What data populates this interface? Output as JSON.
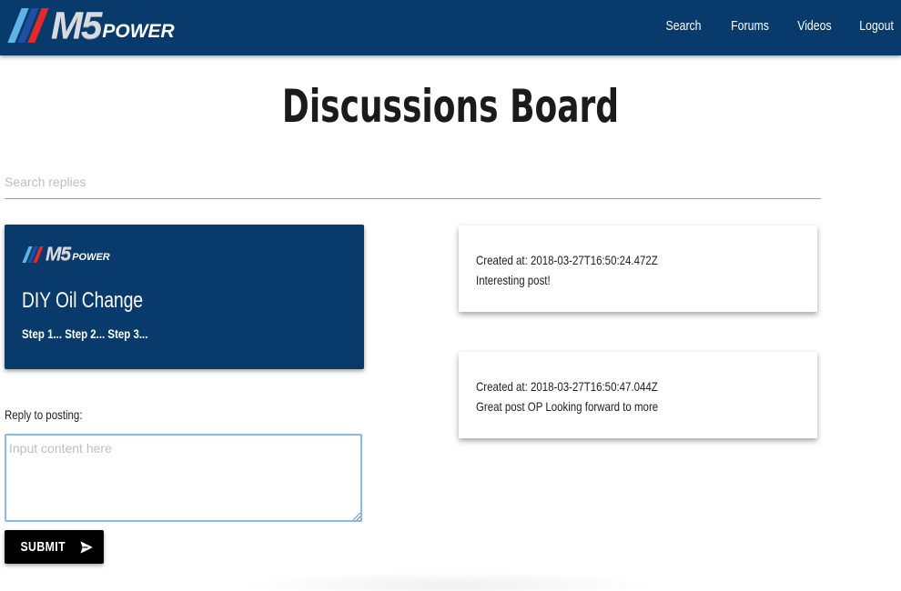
{
  "header": {
    "logo_brand": "M5",
    "logo_suffix": "POWER",
    "nav": [
      "Search",
      "Forums",
      "Videos",
      "Logout"
    ]
  },
  "page_title": "Discussions Board",
  "search": {
    "placeholder": "Search replies",
    "value": ""
  },
  "post": {
    "logo_brand": "M5",
    "logo_suffix": "POWER",
    "title": "DIY Oil Change",
    "body": "Step 1... Step 2... Step 3..."
  },
  "reply_form": {
    "label": "Reply to posting:",
    "placeholder": "Input content here",
    "submit_label": "SUBMIT"
  },
  "replies": [
    {
      "created": "Created at: 2018-03-27T16:50:24.472Z",
      "text": "Interesting post!"
    },
    {
      "created": "Created at: 2018-03-27T16:50:47.044Z",
      "text": "Great post OP Looking forward to more"
    }
  ],
  "colors": {
    "navbar": "#083a6b",
    "button": "#000000",
    "accent_red": "#e22a2a",
    "accent_blue": "#5fb3e6"
  },
  "icons": [
    "send-icon"
  ]
}
